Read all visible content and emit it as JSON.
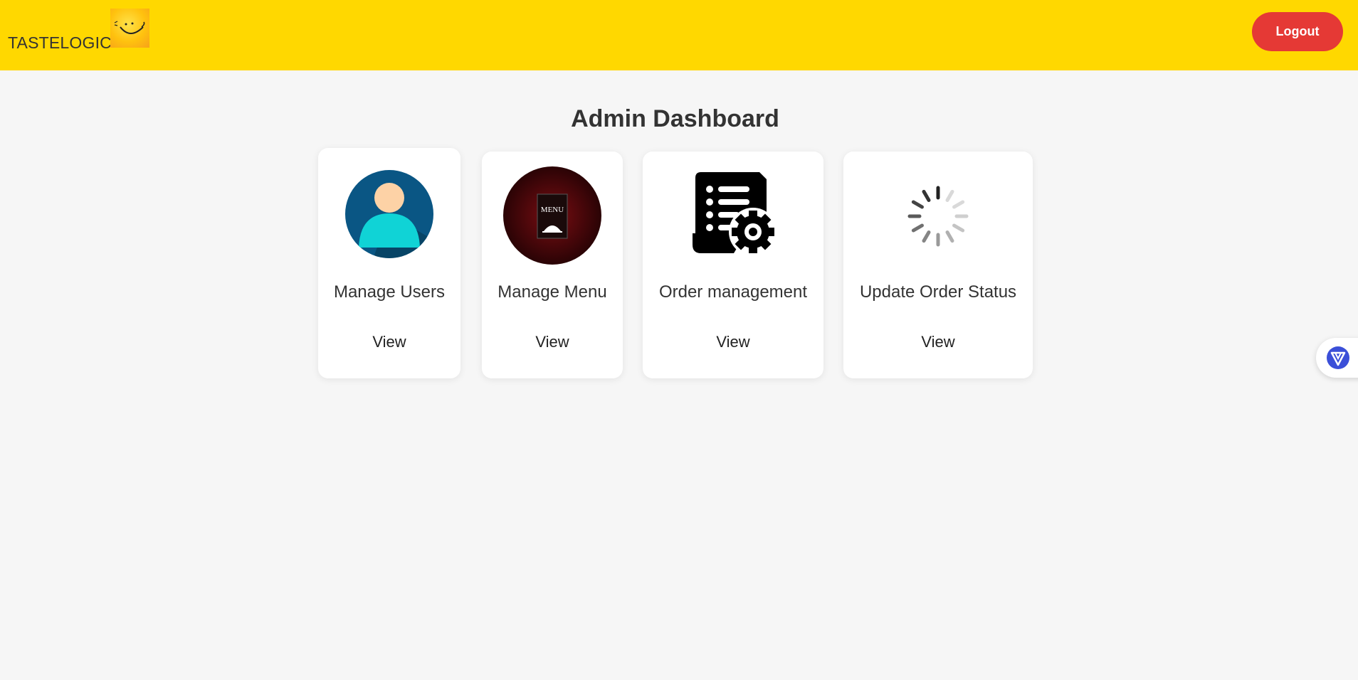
{
  "header": {
    "brand": "TASTELOGIC",
    "background_color": "#ffd800",
    "logout_label": "Logout",
    "logout_color": "#e53935"
  },
  "main": {
    "title": "Admin Dashboard",
    "cards": [
      {
        "label": "Manage Users",
        "icon": "user-avatar-icon",
        "action": "View"
      },
      {
        "label": "Manage Menu",
        "icon": "restaurant-menu-icon",
        "action": "View",
        "icon_text": "MENU"
      },
      {
        "label": "Order management",
        "icon": "order-list-gear-icon",
        "action": "View"
      },
      {
        "label": "Update Order Status",
        "icon": "loading-spinner-icon",
        "action": "View"
      }
    ]
  },
  "side_widget": {
    "icon": "browser-extension-icon"
  }
}
